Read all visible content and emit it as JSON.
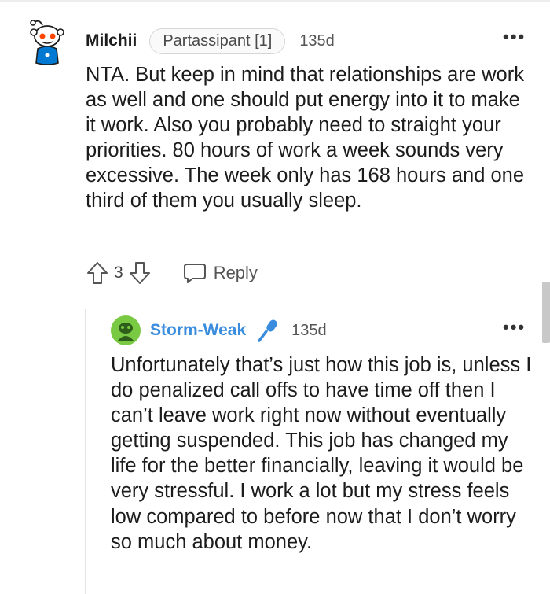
{
  "comment": {
    "username": "Milchii",
    "flair": "Partassipant [1]",
    "age": "135d",
    "more_label": "•••",
    "body": "NTA. But keep in mind that relationships are work as well and one should put energy into it to make it work. Also you probably need to straight your priorities. 80 hours of work a week sounds very excessive. The week only has 168 hours and one third of them you usually sleep.",
    "score": "3",
    "reply_label": "Reply"
  },
  "reply": {
    "username": "Storm-Weak",
    "age": "135d",
    "more_label": "•••",
    "body": "Unfortunately that’s just how this job is, unless I do penalized call offs to have time off then I can’t leave work right now without eventually getting suspended. This job has changed my life for the better financially, leaving it would be very stressful. I work a lot but my stress feels low compared to before now that I don’t worry so much about money."
  },
  "icons": {
    "upvote": "upvote-arrow-icon",
    "downvote": "downvote-arrow-icon",
    "reply": "speech-bubble-icon",
    "mic": "microphone-icon",
    "more": "more-options-icon"
  },
  "colors": {
    "text": "#1c1c1c",
    "username_link": "#3a8dde",
    "mic": "#3a8dde",
    "avatar_red": "#ff4500",
    "avatar_green": "#7ac943"
  }
}
